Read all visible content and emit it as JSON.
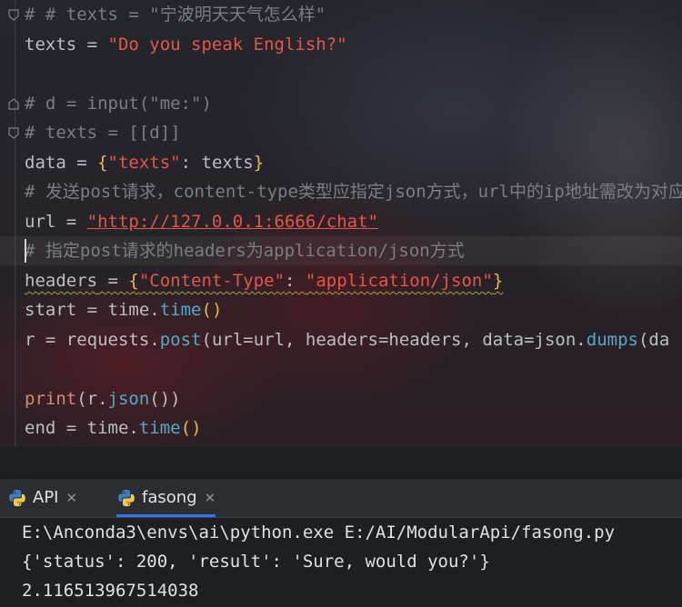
{
  "editor": {
    "lines": [
      {
        "comment": "# # texts = \"宁波明天天气怎么样\""
      },
      {
        "var": "texts",
        "op": " = ",
        "str": "\"Do you speak English?\""
      },
      {
        "comment": "# d = input(\"me:\")"
      },
      {
        "comment": "# texts = [[d]]"
      },
      {
        "var": "data",
        "op": " = ",
        "brace_open": "{",
        "key": "\"texts\"",
        "colon": ": ",
        "val": "texts",
        "brace_close": "}"
      },
      {
        "comment": "# 发送post请求，content-type类型应指定json方式，url中的ip地址需改为对应"
      },
      {
        "var": "url",
        "op": " = ",
        "str": "\"http://127.0.0.1:6666/chat\""
      },
      {
        "comment": "# 指定post请求的headers为application/json方式"
      },
      {
        "var": "headers",
        "op": " = ",
        "brace_open": "{",
        "key": "\"Content-Type\"",
        "colon": ": ",
        "val": "\"application/json\"",
        "brace_close": "}"
      },
      {
        "var": "start",
        "op": " = ",
        "obj": "time.",
        "fn": "time",
        "args": "()"
      },
      {
        "var": "r",
        "op": " = ",
        "obj": "requests.",
        "fn": "post",
        "args": "(url=url, headers=headers, data=json.",
        "fn2": "dumps",
        "args2": "(da"
      },
      {
        "fn": "print",
        "args": "(r.",
        "fn2": "json",
        "args2": "())"
      },
      {
        "var": "end",
        "op": " = ",
        "obj": "time.",
        "fn": "time",
        "args": "()"
      }
    ]
  },
  "tabs": [
    {
      "label": "API",
      "icon": "python-icon"
    },
    {
      "label": "fasong",
      "icon": "python-icon",
      "active": true
    }
  ],
  "console": {
    "command": "E:\\Anconda3\\envs\\ai\\python.exe E:/AI/ModularApi/fasong.py",
    "result": "{'status': 200, 'result': 'Sure, would you?'}",
    "elapsed": "2.116513967514038"
  },
  "colors": {
    "accent": "#3574f0",
    "string": "#e2574a",
    "comment": "#7a7e85",
    "function": "#57a8c8"
  }
}
